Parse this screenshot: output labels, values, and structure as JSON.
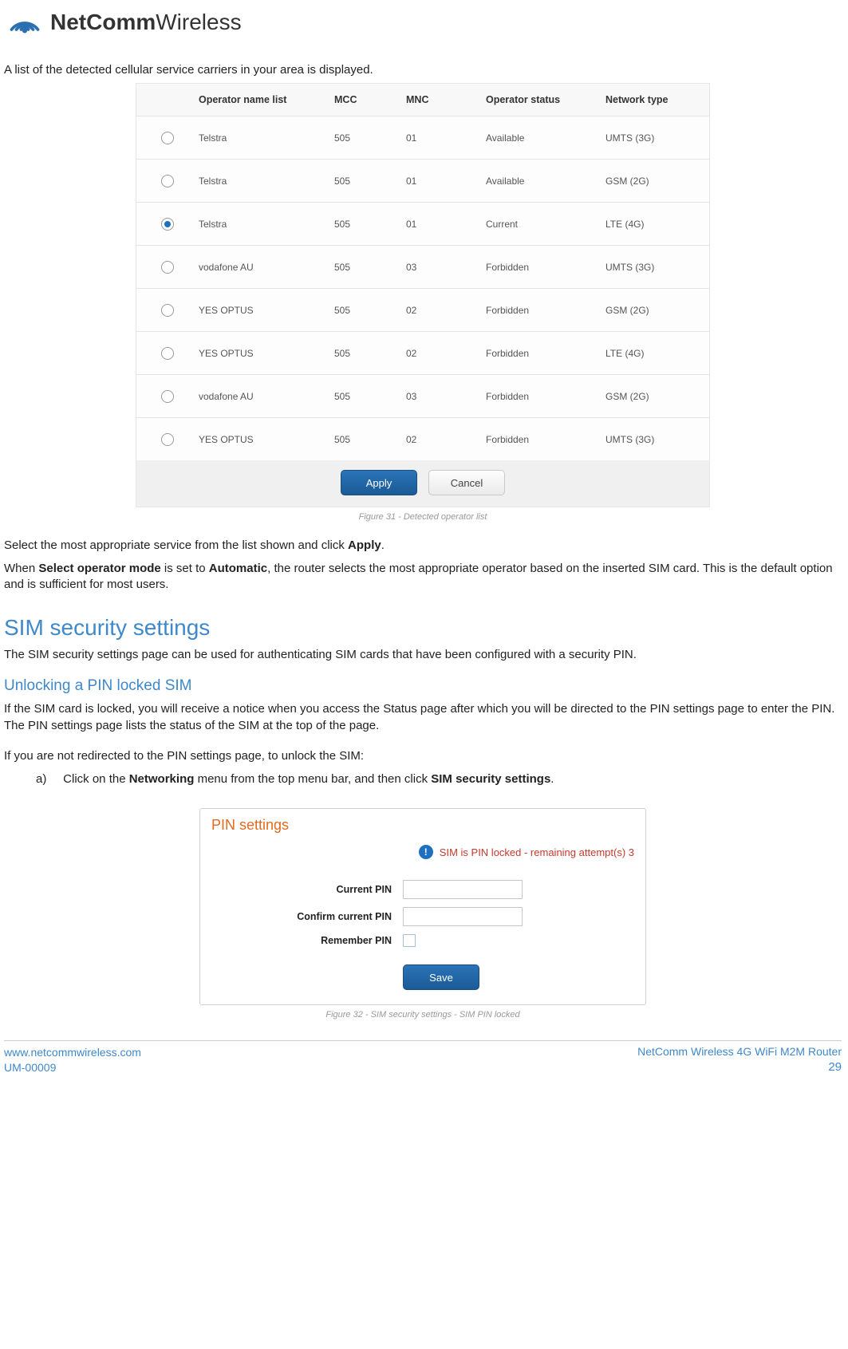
{
  "brand": {
    "bold": "NetComm",
    "light": "Wireless"
  },
  "intro": "A list of the detected cellular service carriers in your area is displayed.",
  "table": {
    "headers": {
      "name": "Operator name list",
      "mcc": "MCC",
      "mnc": "MNC",
      "status": "Operator status",
      "net": "Network type"
    },
    "rows": [
      {
        "name": "Telstra",
        "mcc": "505",
        "mnc": "01",
        "status": "Available",
        "net": "UMTS (3G)",
        "selected": false
      },
      {
        "name": "Telstra",
        "mcc": "505",
        "mnc": "01",
        "status": "Available",
        "net": "GSM (2G)",
        "selected": false
      },
      {
        "name": "Telstra",
        "mcc": "505",
        "mnc": "01",
        "status": "Current",
        "net": "LTE (4G)",
        "selected": true
      },
      {
        "name": "vodafone AU",
        "mcc": "505",
        "mnc": "03",
        "status": "Forbidden",
        "net": "UMTS (3G)",
        "selected": false
      },
      {
        "name": "YES OPTUS",
        "mcc": "505",
        "mnc": "02",
        "status": "Forbidden",
        "net": "GSM (2G)",
        "selected": false
      },
      {
        "name": "YES OPTUS",
        "mcc": "505",
        "mnc": "02",
        "status": "Forbidden",
        "net": "LTE (4G)",
        "selected": false
      },
      {
        "name": "vodafone AU",
        "mcc": "505",
        "mnc": "03",
        "status": "Forbidden",
        "net": "GSM (2G)",
        "selected": false
      },
      {
        "name": "YES OPTUS",
        "mcc": "505",
        "mnc": "02",
        "status": "Forbidden",
        "net": "UMTS (3G)",
        "selected": false
      }
    ],
    "apply": "Apply",
    "cancel": "Cancel"
  },
  "fig31": "Figure 31 - Detected operator list",
  "para1_a": "Select the most appropriate service from the list shown and click ",
  "para1_b": "Apply",
  "para1_c": ".",
  "para2_a": "When ",
  "para2_b": "Select operator mode",
  "para2_c": " is set to ",
  "para2_d": "Automatic",
  "para2_e": ", the router selects the most appropriate operator based on the inserted SIM card. This is the default option and is sufficient for most users.",
  "sim_h": "SIM security settings",
  "sim_p": "The SIM security settings page can be used for authenticating SIM cards that have been configured with a security PIN.",
  "unlock_h": "Unlocking a PIN locked SIM",
  "unlock_p": "If the SIM card is locked, you will receive a notice when you access the Status page after which you will be directed to the PIN settings page to enter the PIN. The PIN settings page lists the status of the SIM at the top of the page.",
  "redirect_p": "If you are not redirected to the PIN settings page, to unlock the SIM:",
  "step_a_label": "a)",
  "step_a_1": "Click on the ",
  "step_a_2": "Networking",
  "step_a_3": " menu from the top menu bar, and then click ",
  "step_a_4": "SIM security settings",
  "step_a_5": ".",
  "pin": {
    "title": "PIN settings",
    "alert": "SIM is PIN locked - remaining attempt(s) 3",
    "current": "Current PIN",
    "confirm": "Confirm current PIN",
    "remember": "Remember PIN",
    "save": "Save"
  },
  "fig32": "Figure 32 - SIM security settings - SIM PIN locked",
  "footer": {
    "url": "www.netcommwireless.com",
    "code": "UM-00009",
    "product": "NetComm Wireless 4G WiFi M2M Router",
    "page": "29"
  }
}
